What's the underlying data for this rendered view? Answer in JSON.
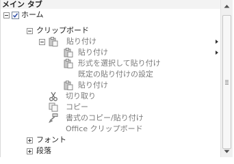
{
  "panel": {
    "title": "メイン タブ"
  },
  "tree": {
    "home": {
      "label": "ホーム",
      "checked": true
    },
    "clipboard": {
      "label": "クリップボード"
    },
    "paste_group": {
      "label": "貼り付け"
    },
    "paste_item": {
      "label": "貼り付け"
    },
    "paste_special": {
      "label": "形式を選択して貼り付け"
    },
    "set_default_paste": {
      "label": "既定の貼り付けの設定"
    },
    "paste_item2": {
      "label": "貼り付け"
    },
    "cut": {
      "label": "切り取り"
    },
    "copy": {
      "label": "コピー"
    },
    "format_painter": {
      "label": "書式のコピー/貼り付け"
    },
    "office_clipboard": {
      "label": "Office クリップボード"
    },
    "font": {
      "label": "フォント"
    },
    "paragraph": {
      "label": "段落"
    }
  }
}
